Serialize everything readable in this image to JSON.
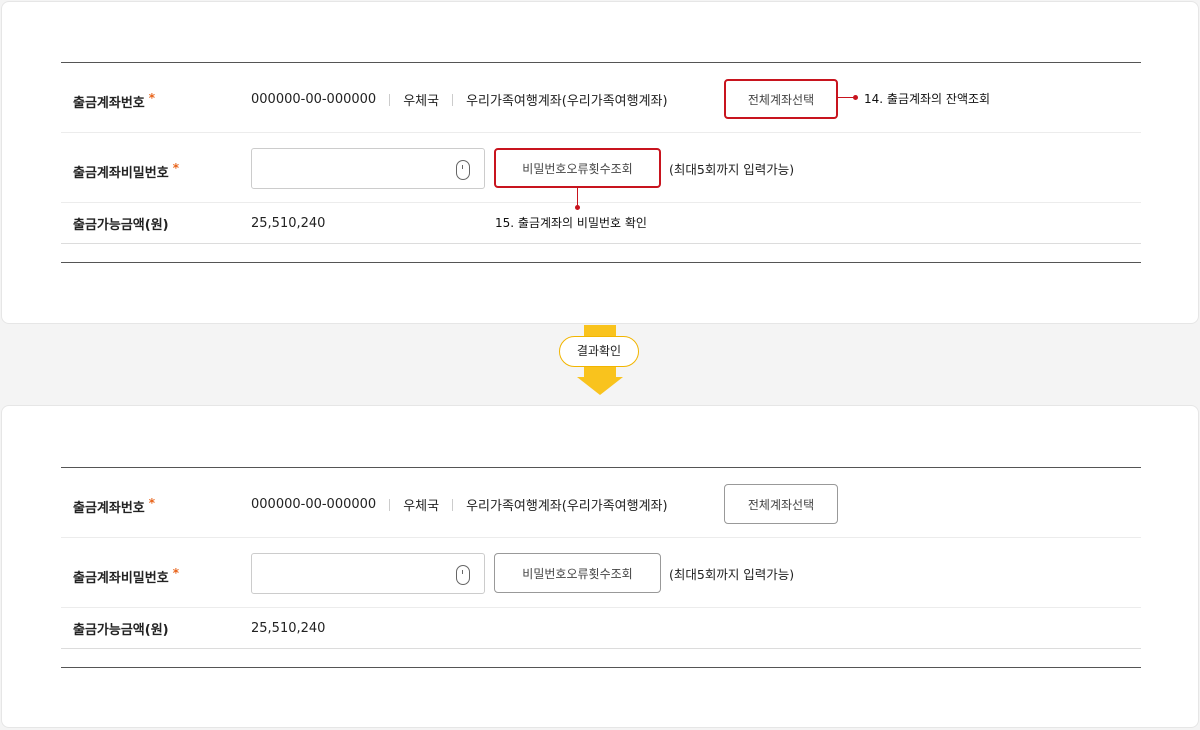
{
  "form": {
    "account_label": "출금계좌번호",
    "required_mark": "*",
    "account_number": "000000-00-000000",
    "bank_name": "우체국",
    "account_name": "우리가족여행계좌(우리가족여행계좌)",
    "select_all_button": "전체계좌선택",
    "password_label": "출금계좌비밀번호",
    "password_value": "",
    "password_error_button": "비밀번호오류횟수조회",
    "password_hint": "(최대5회까지 입력가능)",
    "balance_label": "출금가능금액(원)",
    "balance_value": "25,510,240"
  },
  "annotations": {
    "balance_check": "14. 출금계좌의 잔액조회",
    "password_check": "15. 출금계좌의 비밀번호 확인"
  },
  "flow": {
    "result_label": "결과확인"
  },
  "colors": {
    "highlight": "#c8141e",
    "required": "#e8641b",
    "arrow": "#f9c31d"
  },
  "icons": {
    "password_input": "mouse-icon"
  }
}
